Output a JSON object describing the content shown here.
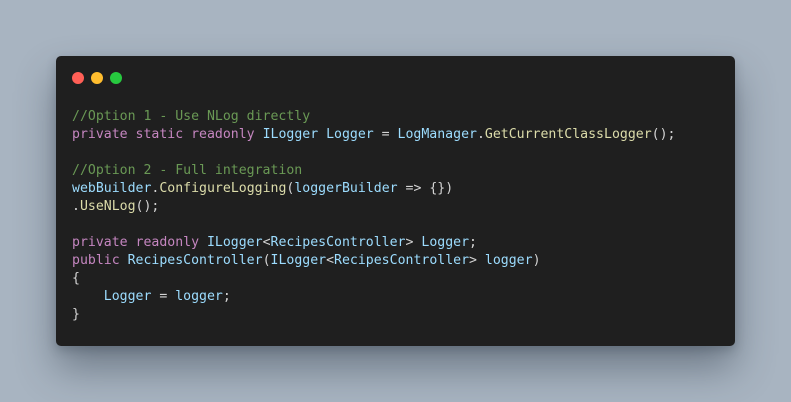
{
  "window": {
    "controls": [
      "close",
      "minimize",
      "maximize"
    ],
    "colors": {
      "close": "#ff5f56",
      "minimize": "#ffbd2e",
      "maximize": "#27c93f",
      "background": "#1f1f1f"
    }
  },
  "code": {
    "lines": [
      {
        "tokens": [
          {
            "text": "//Option 1 - Use NLog directly",
            "class": "c"
          }
        ]
      },
      {
        "tokens": [
          {
            "text": "private static readonly ",
            "class": "k"
          },
          {
            "text": "ILogger Logger",
            "class": "t"
          },
          {
            "text": " = ",
            "class": "p"
          },
          {
            "text": "LogManager",
            "class": "t"
          },
          {
            "text": ".",
            "class": "p"
          },
          {
            "text": "GetCurrentClassLogger",
            "class": "f"
          },
          {
            "text": "();",
            "class": "p"
          }
        ]
      },
      {
        "tokens": []
      },
      {
        "tokens": [
          {
            "text": "//Option 2 - Full integration",
            "class": "c"
          }
        ]
      },
      {
        "tokens": [
          {
            "text": "webBuilder",
            "class": "t"
          },
          {
            "text": ".",
            "class": "p"
          },
          {
            "text": "ConfigureLogging",
            "class": "f"
          },
          {
            "text": "(",
            "class": "p"
          },
          {
            "text": "loggerBuilder",
            "class": "t"
          },
          {
            "text": " => {})",
            "class": "p"
          }
        ]
      },
      {
        "tokens": [
          {
            "text": ".",
            "class": "p"
          },
          {
            "text": "UseNLog",
            "class": "f"
          },
          {
            "text": "();",
            "class": "p"
          }
        ]
      },
      {
        "tokens": []
      },
      {
        "tokens": [
          {
            "text": "private readonly ",
            "class": "k"
          },
          {
            "text": "ILogger",
            "class": "t"
          },
          {
            "text": "<",
            "class": "p"
          },
          {
            "text": "RecipesController",
            "class": "t"
          },
          {
            "text": "> ",
            "class": "p"
          },
          {
            "text": "Logger",
            "class": "t"
          },
          {
            "text": ";",
            "class": "p"
          }
        ]
      },
      {
        "tokens": [
          {
            "text": "public ",
            "class": "k"
          },
          {
            "text": "RecipesController",
            "class": "t"
          },
          {
            "text": "(",
            "class": "p"
          },
          {
            "text": "ILogger",
            "class": "t"
          },
          {
            "text": "<",
            "class": "p"
          },
          {
            "text": "RecipesController",
            "class": "t"
          },
          {
            "text": "> ",
            "class": "p"
          },
          {
            "text": "logger",
            "class": "t"
          },
          {
            "text": ")",
            "class": "p"
          }
        ]
      },
      {
        "tokens": [
          {
            "text": "{",
            "class": "p"
          }
        ]
      },
      {
        "tokens": [
          {
            "text": "    ",
            "class": "p"
          },
          {
            "text": "Logger",
            "class": "t"
          },
          {
            "text": " = ",
            "class": "p"
          },
          {
            "text": "logger",
            "class": "t"
          },
          {
            "text": ";",
            "class": "p"
          }
        ]
      },
      {
        "tokens": [
          {
            "text": "}",
            "class": "p"
          }
        ]
      }
    ]
  }
}
